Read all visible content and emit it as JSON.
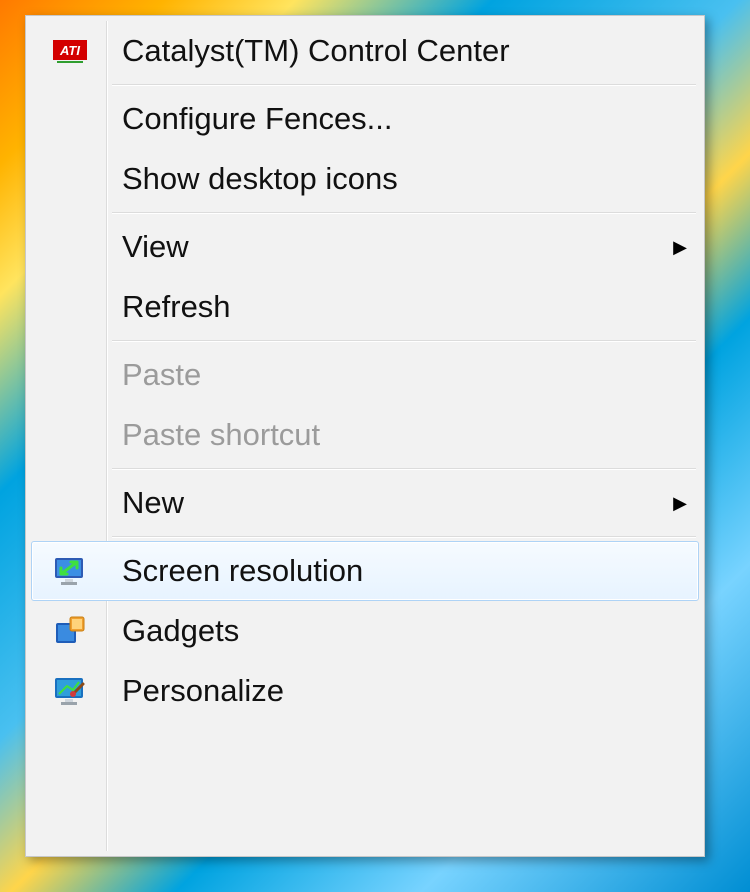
{
  "menu": {
    "items": [
      {
        "label": "Catalyst(TM) Control Center",
        "icon": "ati-icon",
        "disabled": false,
        "submenu": false
      },
      {
        "label": "Configure Fences...",
        "icon": null,
        "disabled": false,
        "submenu": false
      },
      {
        "label": "Show desktop icons",
        "icon": null,
        "disabled": false,
        "submenu": false
      },
      {
        "label": "View",
        "icon": null,
        "disabled": false,
        "submenu": true
      },
      {
        "label": "Refresh",
        "icon": null,
        "disabled": false,
        "submenu": false
      },
      {
        "label": "Paste",
        "icon": null,
        "disabled": true,
        "submenu": false
      },
      {
        "label": "Paste shortcut",
        "icon": null,
        "disabled": true,
        "submenu": false
      },
      {
        "label": "New",
        "icon": null,
        "disabled": false,
        "submenu": true
      },
      {
        "label": "Screen resolution",
        "icon": "screen-resolution-icon",
        "disabled": false,
        "submenu": false,
        "highlighted": true
      },
      {
        "label": "Gadgets",
        "icon": "gadgets-icon",
        "disabled": false,
        "submenu": false
      },
      {
        "label": "Personalize",
        "icon": "personalize-icon",
        "disabled": false,
        "submenu": false
      }
    ]
  },
  "arrow_glyph": "▶"
}
